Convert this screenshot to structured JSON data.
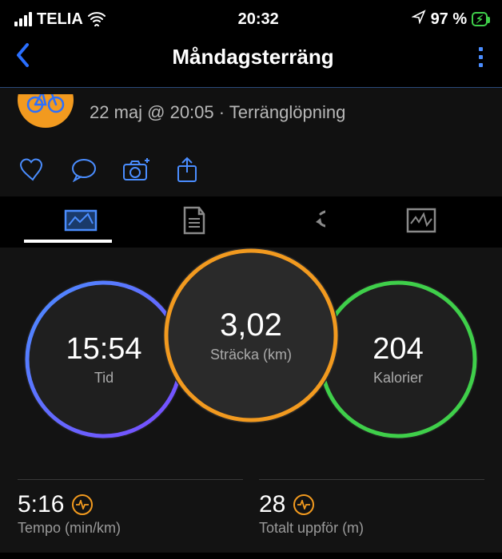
{
  "status": {
    "carrier": "TELIA",
    "time": "20:32",
    "battery_pct": "97 %"
  },
  "header": {
    "title": "Måndagsterräng"
  },
  "activity": {
    "meta": "22 maj @ 20:05 · Terränglöpning"
  },
  "gauges": {
    "distance": {
      "value": "3,02",
      "label": "Sträcka (km)"
    },
    "time": {
      "value": "15:54",
      "label": "Tid"
    },
    "calories": {
      "value": "204",
      "label": "Kalorier"
    }
  },
  "stats": {
    "pace": {
      "value": "5:16",
      "label": "Tempo (min/km)"
    },
    "ascent": {
      "value": "28",
      "label": "Totalt uppför (m)"
    }
  },
  "colors": {
    "accent_blue": "#2a6fff",
    "ring_orange": "#f29a1f",
    "ring_blue": "#5a6bff",
    "ring_green": "#3fcf4a"
  }
}
